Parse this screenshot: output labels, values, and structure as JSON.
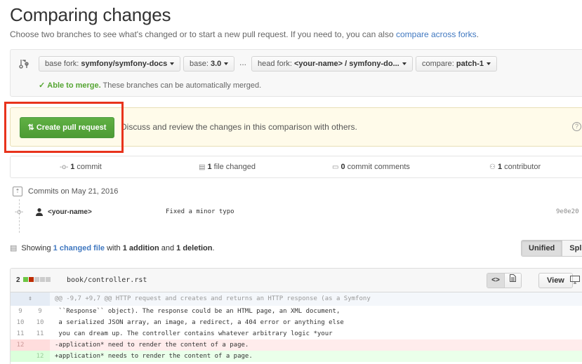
{
  "header": {
    "title": "Comparing changes",
    "subtitle": "Choose two branches to see what's changed or to start a new pull request. If you need to, you can also ",
    "subtitle_link": "compare across forks",
    "subtitle_end": "."
  },
  "range": {
    "base_fork_label": "base fork:",
    "base_fork_value": "symfony/symfony-docs",
    "base_label": "base:",
    "base_value": "3.0",
    "ellipsis": "...",
    "head_fork_label": "head fork:",
    "head_fork_value": "<your-name> / symfony-do...",
    "compare_label": "compare:",
    "compare_value": "patch-1",
    "merge_status": "Able to merge.",
    "merge_detail": "These branches can be automatically merged."
  },
  "pull_request": {
    "button_label": "Create pull request",
    "description": "Discuss and review the changes in this comparison with others."
  },
  "stats": {
    "commits_count": "1",
    "commits_label": "commit",
    "files_count": "1",
    "files_label": "file changed",
    "comments_count": "0",
    "comments_label": "commit comments",
    "contributors_count": "1",
    "contributors_label": "contributor"
  },
  "commits": {
    "date_heading": "Commits on May 21, 2016",
    "items": [
      {
        "author": "<your-name>",
        "message": "Fixed a minor typo",
        "sha": "9e0e20"
      }
    ]
  },
  "summary": {
    "prefix": "Showing ",
    "changed_files": "1 changed file",
    "middle": " with ",
    "additions": "1 addition",
    "and": " and ",
    "deletions": "1 deletion",
    "end": "."
  },
  "view_toggle": {
    "unified": "Unified",
    "split": "Split"
  },
  "file": {
    "change_count": "2",
    "path": "book/controller.rst",
    "code_btn": "<>",
    "view_btn": "View",
    "diffstat": {
      "additions": 1,
      "deletions": 1,
      "neutral": 3
    },
    "hunk_header": "@@ -9,7 +9,7 @@ HTTP request and creates and returns an HTTP response (as a Symfony",
    "lines": [
      {
        "type": "ctx",
        "old": "9",
        "new": "9",
        "text": " ``Response`` object). The response could be an HTML page, an XML document,"
      },
      {
        "type": "ctx",
        "old": "10",
        "new": "10",
        "text": " a serialized JSON array, an image, a redirect, a 404 error or anything else"
      },
      {
        "type": "ctx",
        "old": "11",
        "new": "11",
        "text": " you can dream up. The controller contains whatever arbitrary logic *your"
      },
      {
        "type": "del",
        "old": "12",
        "new": "",
        "text": "-application* need to render the content of a page."
      },
      {
        "type": "add",
        "old": "",
        "new": "12",
        "text": "+application* needs to render the content of a page."
      }
    ]
  },
  "colors": {
    "accent_link": "#4078c0",
    "merge_green": "#55a532",
    "button_green": "#60b044",
    "highlight_frame": "#e8331c"
  }
}
